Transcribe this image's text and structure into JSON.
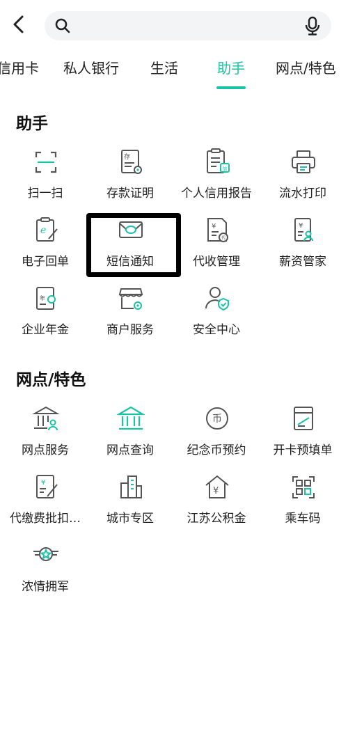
{
  "header": {
    "search_placeholder": ""
  },
  "tabs": [
    {
      "label": "信用卡"
    },
    {
      "label": "私人银行"
    },
    {
      "label": "生活"
    },
    {
      "label": "助手",
      "active": true
    },
    {
      "label": "网点/特色"
    }
  ],
  "sections": [
    {
      "title": "助手",
      "items": [
        {
          "label": "扫一扫",
          "icon": "scan-icon"
        },
        {
          "label": "存款证明",
          "icon": "deposit-certificate-icon"
        },
        {
          "label": "个人信用报告",
          "icon": "credit-report-icon"
        },
        {
          "label": "流水打印",
          "icon": "printer-icon"
        },
        {
          "label": "电子回单",
          "icon": "e-receipt-icon"
        },
        {
          "label": "短信通知",
          "icon": "sms-envelope-icon"
        },
        {
          "label": "代收管理",
          "icon": "collection-management-icon"
        },
        {
          "label": "薪资管家",
          "icon": "salary-manager-icon"
        },
        {
          "label": "企业年金",
          "icon": "enterprise-annuity-icon"
        },
        {
          "label": "商户服务",
          "icon": "merchant-store-icon"
        },
        {
          "label": "安全中心",
          "icon": "security-user-icon"
        }
      ]
    },
    {
      "title": "网点/特色",
      "items": [
        {
          "label": "网点服务",
          "icon": "branch-service-icon"
        },
        {
          "label": "网点查询",
          "icon": "bank-building-icon"
        },
        {
          "label": "纪念币预约",
          "icon": "coin-icon"
        },
        {
          "label": "开卡预填单",
          "icon": "card-form-icon"
        },
        {
          "label": "代缴费批扣…",
          "icon": "bill-payment-icon"
        },
        {
          "label": "城市专区",
          "icon": "city-buildings-icon"
        },
        {
          "label": "江苏公积金",
          "icon": "housing-fund-icon"
        },
        {
          "label": "乘车码",
          "icon": "qr-code-icon"
        },
        {
          "label": "浓情拥军",
          "icon": "military-star-icon"
        }
      ]
    }
  ],
  "colors": {
    "accent": "#19c3a5",
    "icon_stroke": "#555555",
    "highlight_border": "#000000"
  }
}
